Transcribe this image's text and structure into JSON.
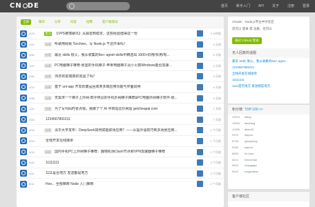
{
  "header": {
    "logo": "cnode",
    "nav": [
      "首页",
      "新手入门",
      "API",
      "关于",
      "注册",
      "登录"
    ]
  },
  "tabs": [
    "全部",
    "精华",
    "分享",
    "问答",
    "招聘",
    "客户端测试"
  ],
  "topics": [
    {
      "count": "2/13",
      "badge": "置顶",
      "title": "【VPS被墙避坑】从踩雷到稳定，这些经验值得这一份",
      "time": "3 小时前"
    },
    {
      "count": "1/12",
      "badge": "分享",
      "title": "听歌用网易 Torchion，写 Node.js 干这件事吗！",
      "time": "5 天前"
    },
    {
      "count": "4/90",
      "badge": "分享",
      "title": "最近 skills 很火，我从收集的6w+ agnet-skills中精选出 1000+好用/实用/有...",
      "time": "8 天前"
    },
    {
      "count": "1/17",
      "badge": "分享",
      "title": "PC电脑梯子推荐-便宜的手机梯子-苹果电脑梯子及小火箭Windows能否加速...",
      "time": "9 天前"
    },
    {
      "count": "2/51",
      "badge": "分享",
      "title": "35岁的前端真的完蛋了吗？",
      "time": "9 天前"
    },
    {
      "count": "1/12",
      "badge": "分享",
      "title": "基于 uni-app 开发的废品回收类多端应用功能与界面说明",
      "time": "9 天前"
    },
    {
      "count": "4/48",
      "badge": "分享",
      "title": "无需求一个梯子上外网-知乎热议的手机外网梯子推荐&PC电脑外网梯子软件-便...",
      "time": "9 天前"
    },
    {
      "count": "1/11",
      "badge": "分享",
      "title": "为了写代码时省点钱，我做了个 AI 中转站比价网站 getcheapai.com",
      "time": "1 天前"
    },
    {
      "count": "0/10",
      "badge": "",
      "title": "1234567891011",
      "time": "7 天前"
    },
    {
      "count": "0/13",
      "badge": "分享",
      "title": "清华大学发布：DeepSeek如何赋能职场应用？——从提示语技巧到多场景应用...",
      "time": "1 个月前"
    },
    {
      "count": "3/14",
      "badge": "",
      "title": "全栈开发在线接单",
      "time": "1 个月前"
    },
    {
      "count": "1/14",
      "badge": "分享",
      "title": "国内手机PC上外网梯子推荐：翻墙机场Clash节点和VPN加速器梯子推荐",
      "time": "2 个月前"
    },
    {
      "count": "0/10",
      "badge": "",
      "title": "11111111",
      "time": "2 个月前"
    },
    {
      "count": "0/11",
      "badge": "",
      "title": "1111是否地方 发送都是地方",
      "time": "2 个月前"
    },
    {
      "count": "0/11",
      "badge": "",
      "title": "Hoo... 全部推荐 Node 入门推荐",
      "time": "2 个月前"
    }
  ],
  "sidebar": {
    "intro_title": "CNode：Node.js专业中文社区",
    "intro_text": "您可以 登录 或 注册，也可以",
    "github_btn": "通过 GitHub 登录",
    "no_reply_title": "无人回复的话题",
    "no_reply": [
      "最近 skills 很火，我从收集的6w+ agne...",
      "1234567891011",
      "全栈开发在线接单",
      "11111111",
      "1111是否地方 发送都是地方"
    ],
    "top_title": "积分榜",
    "top_link": "TOP 100 >>",
    "ranks": [
      {
        "score": "23570",
        "name": "i5ting"
      },
      {
        "score": "15640",
        "name": "alsotang"
      },
      {
        "score": "10390",
        "name": "atian25"
      },
      {
        "score": "9375",
        "name": "leapon"
      },
      {
        "score": "8795",
        "name": "jiyinyiyong"
      },
      {
        "score": "8160",
        "name": "yakczh"
      },
      {
        "score": "8855",
        "name": "im-here"
      },
      {
        "score": "6210",
        "name": "DevinXian"
      },
      {
        "score": "5815",
        "name": "chapgaga"
      },
      {
        "score": "5400",
        "name": "magicdawn"
      }
    ],
    "client_title": "客户端社区"
  }
}
